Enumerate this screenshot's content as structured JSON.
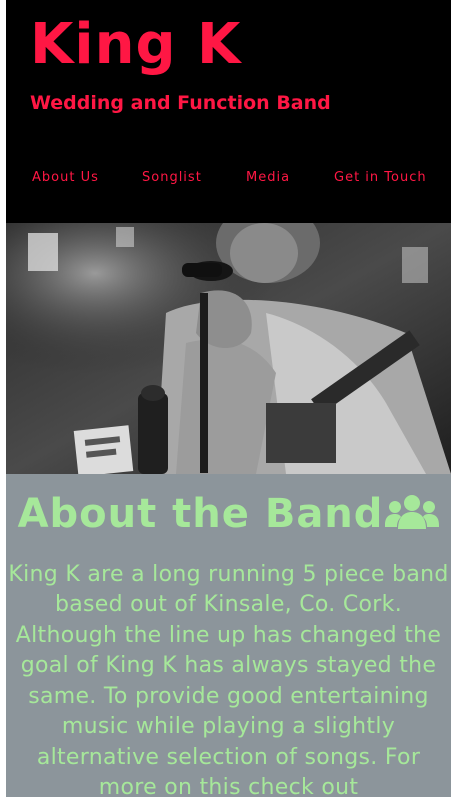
{
  "brand": {
    "name": "King K",
    "tagline": "Wedding and Function Band"
  },
  "nav": {
    "items": [
      {
        "label": "About Us"
      },
      {
        "label": "Songlist"
      },
      {
        "label": "Media"
      },
      {
        "label": "Get in Touch"
      }
    ]
  },
  "hero": {
    "icon": "band-photo"
  },
  "about": {
    "title": "About the Band",
    "icon": "users-icon",
    "text": "King K are a long running 5 piece band based out of Kinsale, Co. Cork. Although the line up has changed the goal of King K has always stayed the same. To provide good entertaining music while playing a slightly alternative selection of songs. For more on this check out"
  },
  "colors": {
    "accent": "#ff1744",
    "header_bg": "#000000",
    "about_bg": "#8c959b",
    "about_text": "#a6e89a"
  }
}
